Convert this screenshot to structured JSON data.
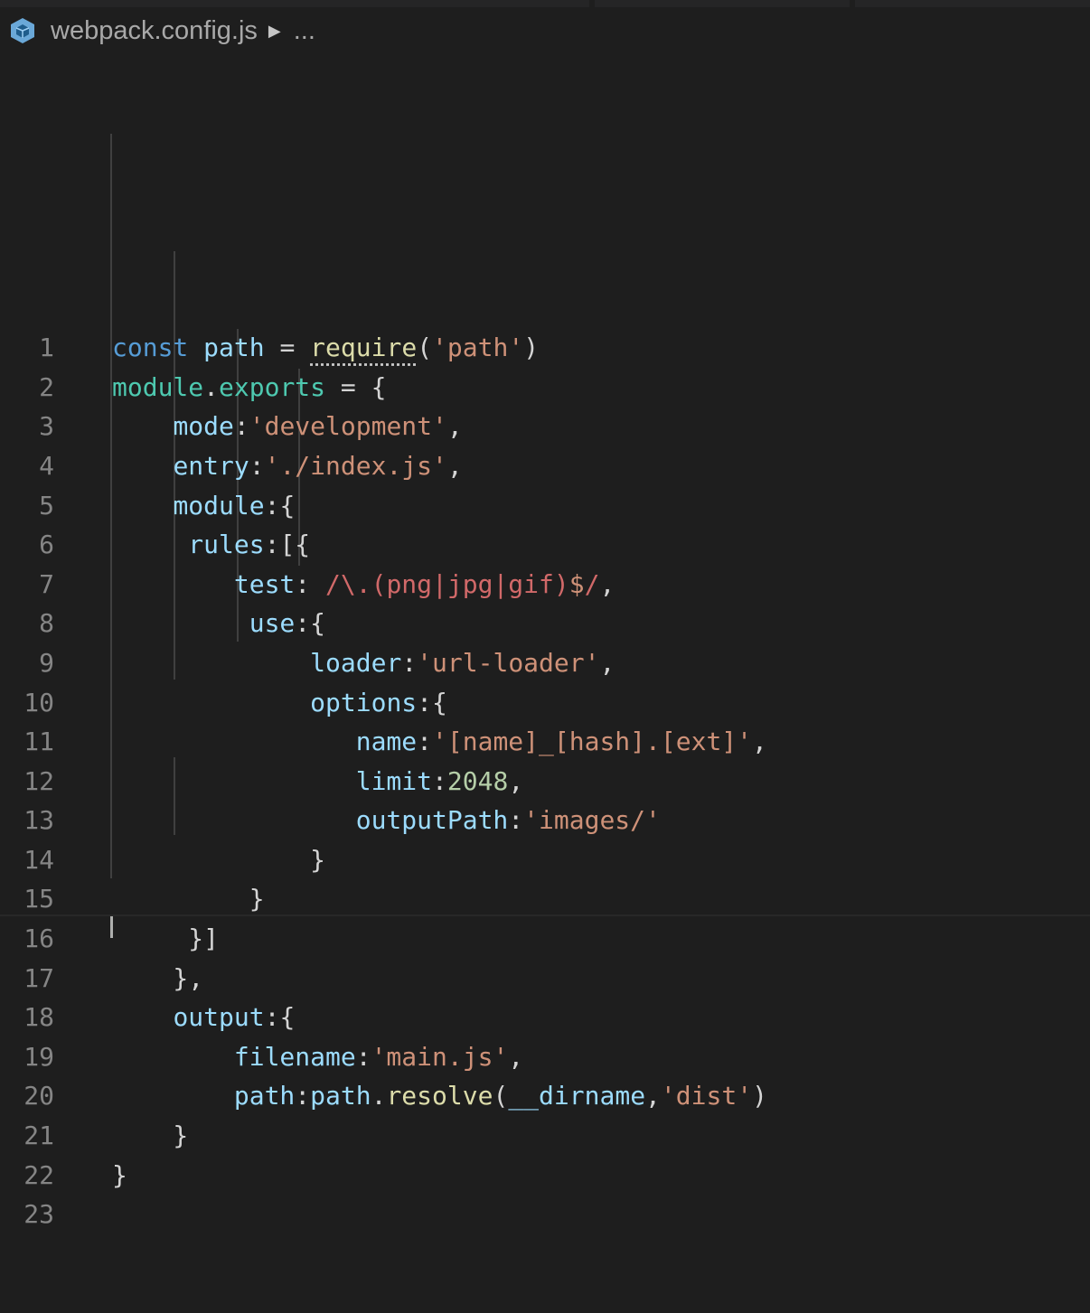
{
  "breadcrumb": {
    "file_icon": "webpack-cube-icon",
    "file_name": "webpack.config.js",
    "separator_icon": "chevron-right-icon",
    "more": "..."
  },
  "colors": {
    "keyword": "#569cd6",
    "variable": "#9cdcfe",
    "module": "#4ec9b0",
    "function": "#dcdcaa",
    "string": "#ce9178",
    "number": "#b5cea8",
    "regex": "#d16969",
    "punctuation": "#d4d4d4",
    "line_number": "#858585"
  },
  "editor": {
    "lines": [
      {
        "n": "1",
        "tokens": [
          [
            "kw",
            "const"
          ],
          [
            "p",
            " "
          ],
          [
            "var",
            "path"
          ],
          [
            "p",
            " = "
          ],
          [
            "fn",
            "require"
          ],
          [
            "p",
            "("
          ],
          [
            "str",
            "'path'"
          ],
          [
            "p",
            ")"
          ]
        ]
      },
      {
        "n": "2",
        "tokens": [
          [
            "mod",
            "module"
          ],
          [
            "p",
            "."
          ],
          [
            "mod",
            "exports"
          ],
          [
            "p",
            " = {"
          ]
        ]
      },
      {
        "n": "3",
        "tokens": [
          [
            "p",
            "    "
          ],
          [
            "var",
            "mode"
          ],
          [
            "p",
            ":"
          ],
          [
            "str",
            "'development'"
          ],
          [
            "p",
            ","
          ]
        ]
      },
      {
        "n": "4",
        "tokens": [
          [
            "p",
            "    "
          ],
          [
            "var",
            "entry"
          ],
          [
            "p",
            ":"
          ],
          [
            "str",
            "'./index.js'"
          ],
          [
            "p",
            ","
          ]
        ]
      },
      {
        "n": "5",
        "tokens": [
          [
            "p",
            "    "
          ],
          [
            "var",
            "module"
          ],
          [
            "p",
            ":{"
          ]
        ]
      },
      {
        "n": "6",
        "tokens": [
          [
            "p",
            "     "
          ],
          [
            "var",
            "rules"
          ],
          [
            "p",
            ":[{"
          ]
        ]
      },
      {
        "n": "7",
        "tokens": [
          [
            "p",
            "        "
          ],
          [
            "var",
            "test"
          ],
          [
            "p",
            ": "
          ],
          [
            "re",
            "/\\.(png|jpg|gif)"
          ],
          [
            "str",
            "$"
          ],
          [
            "re",
            "/"
          ],
          [
            "p",
            ","
          ]
        ]
      },
      {
        "n": "8",
        "tokens": [
          [
            "p",
            "         "
          ],
          [
            "var",
            "use"
          ],
          [
            "p",
            ":{"
          ]
        ]
      },
      {
        "n": "9",
        "tokens": [
          [
            "p",
            "             "
          ],
          [
            "var",
            "loader"
          ],
          [
            "p",
            ":"
          ],
          [
            "str",
            "'url-loader'"
          ],
          [
            "p",
            ","
          ]
        ]
      },
      {
        "n": "10",
        "tokens": [
          [
            "p",
            "             "
          ],
          [
            "var",
            "options"
          ],
          [
            "p",
            ":{"
          ]
        ]
      },
      {
        "n": "11",
        "tokens": [
          [
            "p",
            "                "
          ],
          [
            "var",
            "name"
          ],
          [
            "p",
            ":"
          ],
          [
            "str",
            "'[name]_[hash].[ext]'"
          ],
          [
            "p",
            ","
          ]
        ]
      },
      {
        "n": "12",
        "tokens": [
          [
            "p",
            "                "
          ],
          [
            "var",
            "limit"
          ],
          [
            "p",
            ":"
          ],
          [
            "num",
            "2048"
          ],
          [
            "p",
            ","
          ]
        ]
      },
      {
        "n": "13",
        "tokens": [
          [
            "p",
            "                "
          ],
          [
            "var",
            "outputPath"
          ],
          [
            "p",
            ":"
          ],
          [
            "str",
            "'images/'"
          ]
        ]
      },
      {
        "n": "14",
        "tokens": [
          [
            "p",
            "             }"
          ]
        ]
      },
      {
        "n": "15",
        "tokens": [
          [
            "p",
            "         }"
          ]
        ]
      },
      {
        "n": "16",
        "tokens": [
          [
            "p",
            "     }]"
          ]
        ]
      },
      {
        "n": "17",
        "tokens": [
          [
            "p",
            "    },"
          ]
        ]
      },
      {
        "n": "18",
        "tokens": [
          [
            "p",
            "    "
          ],
          [
            "var",
            "output"
          ],
          [
            "p",
            ":{"
          ]
        ]
      },
      {
        "n": "19",
        "tokens": [
          [
            "p",
            "        "
          ],
          [
            "var",
            "filename"
          ],
          [
            "p",
            ":"
          ],
          [
            "str",
            "'main.js'"
          ],
          [
            "p",
            ","
          ]
        ]
      },
      {
        "n": "20",
        "tokens": [
          [
            "p",
            "        "
          ],
          [
            "var",
            "path"
          ],
          [
            "p",
            ":"
          ],
          [
            "var",
            "path"
          ],
          [
            "p",
            "."
          ],
          [
            "fn",
            "resolve"
          ],
          [
            "p",
            "("
          ],
          [
            "var",
            "__dirname"
          ],
          [
            "p",
            ","
          ],
          [
            "str",
            "'dist'"
          ],
          [
            "p",
            ")"
          ]
        ]
      },
      {
        "n": "21",
        "tokens": [
          [
            "p",
            "    }"
          ]
        ]
      },
      {
        "n": "22",
        "tokens": [
          [
            "p",
            "}"
          ]
        ]
      },
      {
        "n": "23",
        "tokens": []
      }
    ]
  }
}
